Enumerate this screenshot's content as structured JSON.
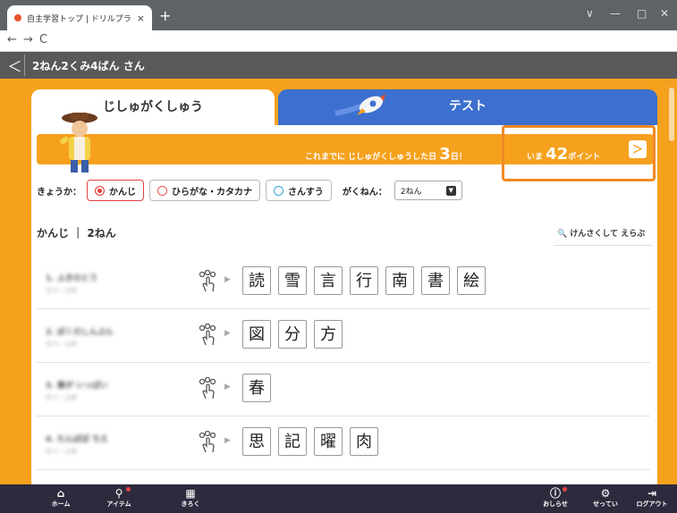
{
  "browser": {
    "tab_title": "自主学習トップ | ドリルプラネット | ",
    "close_glyph": "×",
    "new_tab_glyph": "+",
    "back_glyph": "←",
    "forward_glyph": "→",
    "reload_glyph": "C",
    "min_glyph": "∨",
    "minimize_glyph": "—",
    "maximize_glyph": "□",
    "winclose_glyph": "✕"
  },
  "header": {
    "back_glyph": "＜",
    "user": "2ねん2くみ4ばん さん"
  },
  "tabs": {
    "jishu": "じしゅがくしゅう",
    "test": "テスト"
  },
  "banner": {
    "prefix": "これまでに じしゅがくしゅうした日",
    "days": "3",
    "days_unit": "日！",
    "points_prefix": "いま",
    "points": "42",
    "points_unit": "ポイント",
    "arrow": "＞"
  },
  "filters": {
    "subject_label": "きょうか：",
    "subjects": [
      "かんじ",
      "ひらがな・カタカナ",
      "さんすう"
    ],
    "selected_subject": "かんじ",
    "grade_label": "がくねん：",
    "grade_value": "2ねん",
    "grade_dd": "▼"
  },
  "section": {
    "title": "かんじ ｜ 2ねん",
    "search_link": "けんさくして えらぶ"
  },
  "rows": [
    {
      "meta1": "1. ふきのとう",
      "meta2": "なつ・ふゆ",
      "kanji": [
        "読",
        "雪",
        "言",
        "行",
        "南",
        "書",
        "絵"
      ]
    },
    {
      "meta1": "2. ぼくのしんぶん",
      "meta2": "なつ・ふゆ",
      "kanji": [
        "図",
        "分",
        "方"
      ]
    },
    {
      "meta1": "3. 春が いっぱい",
      "meta2": "なつ・ふゆ",
      "kanji": [
        "春"
      ]
    },
    {
      "meta1": "4. たんぽぽ ちえ",
      "meta2": "なつ・ふゆ",
      "kanji": [
        "思",
        "記",
        "曜",
        "肉"
      ]
    }
  ],
  "play_glyph": "▶",
  "nav": {
    "home": "ホーム",
    "item": "アイテム",
    "record": "きろく",
    "notice": "おしらせ",
    "settings": "せってい",
    "logout": "ログアウト"
  },
  "colors": {
    "accent": "#f6a11e",
    "test_tab": "#3c6fcf",
    "nav_bg": "#2d2a3d",
    "highlight": "#f08a24"
  }
}
